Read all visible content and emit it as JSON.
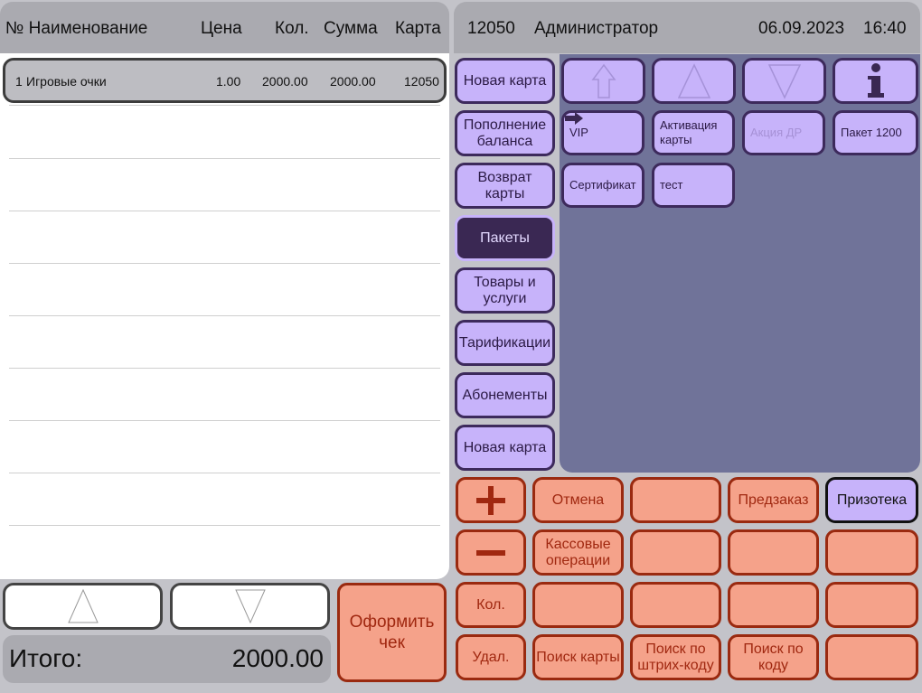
{
  "receipt": {
    "columns": {
      "num_name": "№ Наименование",
      "price": "Цена",
      "qty": "Кол.",
      "sum": "Сумма",
      "card": "Карта"
    },
    "items": [
      {
        "num": "1",
        "name": "Игровые очки",
        "price": "1.00",
        "qty": "2000.00",
        "sum": "2000.00",
        "card": "12050"
      }
    ],
    "total_label": "Итого:",
    "total_value": "2000.00"
  },
  "header": {
    "card_number": "12050",
    "user": "Администратор",
    "date": "06.09.2023",
    "time": "16:40"
  },
  "categories": [
    "Новая карта",
    "Пополнение баланса",
    "Возврат карты",
    "Пакеты",
    "Товары и услуги",
    "Тарификации",
    "Абонементы",
    "Новая карта"
  ],
  "active_category": "Пакеты",
  "tiles": [
    {
      "label": "VIP"
    },
    {
      "label": "Активация карты"
    },
    {
      "label": "Акция ДР"
    },
    {
      "label": "Пакет 1200"
    },
    {
      "label": "Сертификат"
    },
    {
      "label": "тест"
    }
  ],
  "actions": {
    "checkout": "Оформить чек",
    "cancel": "Отмена",
    "preorder": "Предзаказ",
    "prize": "Призотека",
    "cash_ops": "Кассовые операции",
    "qty": "Кол.",
    "delete": "Удал.",
    "find_card": "Поиск карты",
    "find_barcode": "Поиск по штрих-коду",
    "find_code": "Поиск по коду"
  },
  "icons": {
    "plus": "plus-icon",
    "minus": "minus-icon",
    "info": "info-icon",
    "up": "arrow-up-icon",
    "down": "arrow-down-icon"
  },
  "colors": {
    "purple": "#c7b3fa",
    "purple_dark": "#3a2853",
    "panel": "#707399",
    "salmon": "#f5a28a",
    "salmon_border": "#9a2a10",
    "gray": "#aaaab0"
  }
}
